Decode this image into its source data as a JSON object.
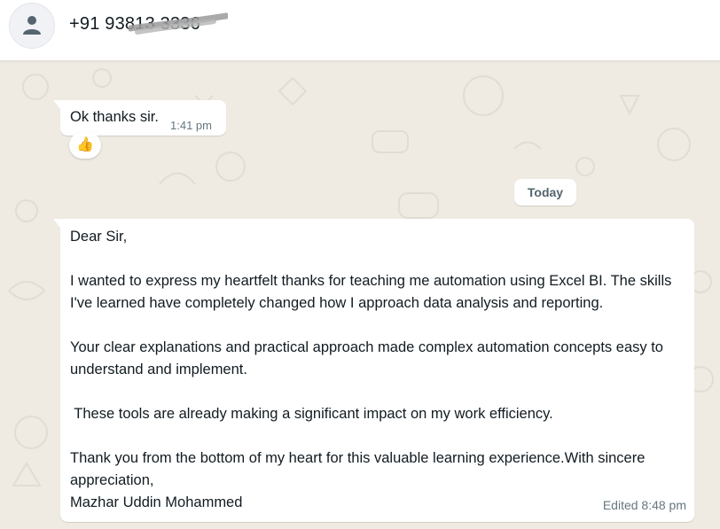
{
  "header": {
    "contact_name": "+91 93813 3336",
    "avatar_icon": "user-avatar-icon"
  },
  "messages": {
    "first": {
      "text": "Ok thanks sir.",
      "time": "1:41 pm",
      "reaction": "👍"
    },
    "date_divider": "Today",
    "second": {
      "lines": [
        "Dear Sir,",
        "",
        "I wanted to express my heartfelt thanks for teaching me automation using Excel BI. The skills I've learned have completely changed how I approach data analysis and reporting.",
        "",
        "Your clear explanations and practical approach made complex automation concepts easy to understand and implement.",
        "",
        " These tools are already making a significant impact on my work efficiency.",
        "",
        "Thank you from the bottom of my heart for this valuable learning experience.With sincere appreciation,",
        "Mazhar Uddin Mohammed"
      ],
      "time": "Edited 8:48 pm"
    }
  },
  "colors": {
    "chat_background": "#efeae2",
    "bubble": "#ffffff",
    "meta_text": "#667781"
  }
}
